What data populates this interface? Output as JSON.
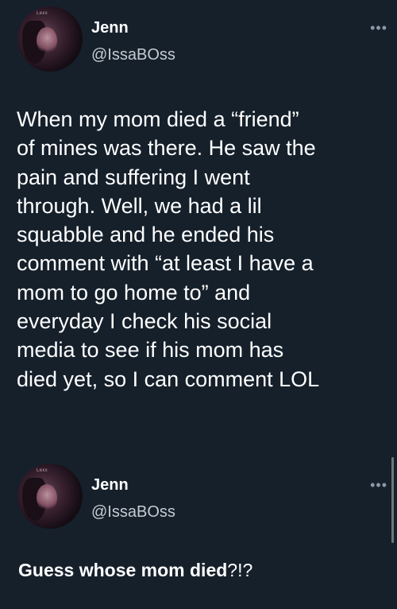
{
  "tweets": [
    {
      "author": {
        "name": "Jenn",
        "handle": "@IssaBOss",
        "avatar_tag": "Lexx"
      },
      "more_icon": "more-horizontal-icon",
      "more_label": "•••",
      "text": "When my mom died a “friend”\nof mines was there. He saw the\npain and suffering I went\nthrough. Well, we had a lil\nsquabble and he ended his\ncomment with “at least I have a\nmom to go home to” and\neveryday I check his social\nmedia to see if his mom has\ndied yet, so I can comment LOL"
    },
    {
      "author": {
        "name": "Jenn",
        "handle": "@IssaBOss",
        "avatar_tag": "Lexx"
      },
      "more_icon": "more-horizontal-icon",
      "more_label": "•••",
      "text_bold": "Guess whose mom died",
      "text_rest": "?!?"
    }
  ],
  "colors": {
    "background": "#15202b",
    "primary_text": "#ffffff",
    "secondary_text": "#c5cbd1",
    "icon": "#8b98a5"
  }
}
